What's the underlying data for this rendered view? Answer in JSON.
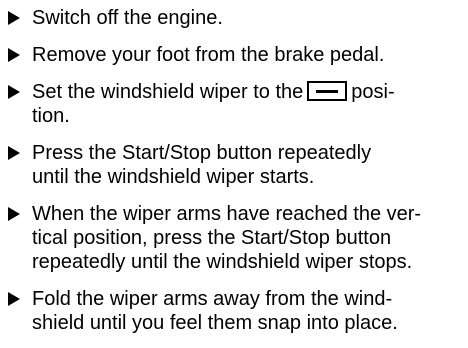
{
  "steps": [
    {
      "text": "Switch off the engine."
    },
    {
      "text": "Remove your foot from the brake pedal."
    },
    {
      "text_before": "Set the windshield wiper to the",
      "icon": "wiper-position-icon",
      "text_after": "posi-",
      "text_line2": "tion."
    },
    {
      "line1": "Press the Start/Stop button repeatedly",
      "line2": "until the windshield wiper starts."
    },
    {
      "line1": "When the wiper arms have reached the ver-",
      "line2": "tical position, press the Start/Stop button",
      "line3": "repeatedly until the windshield wiper stops."
    },
    {
      "line1": "Fold the wiper arms away from the wind-",
      "line2": "shield until you feel them snap into place."
    }
  ]
}
